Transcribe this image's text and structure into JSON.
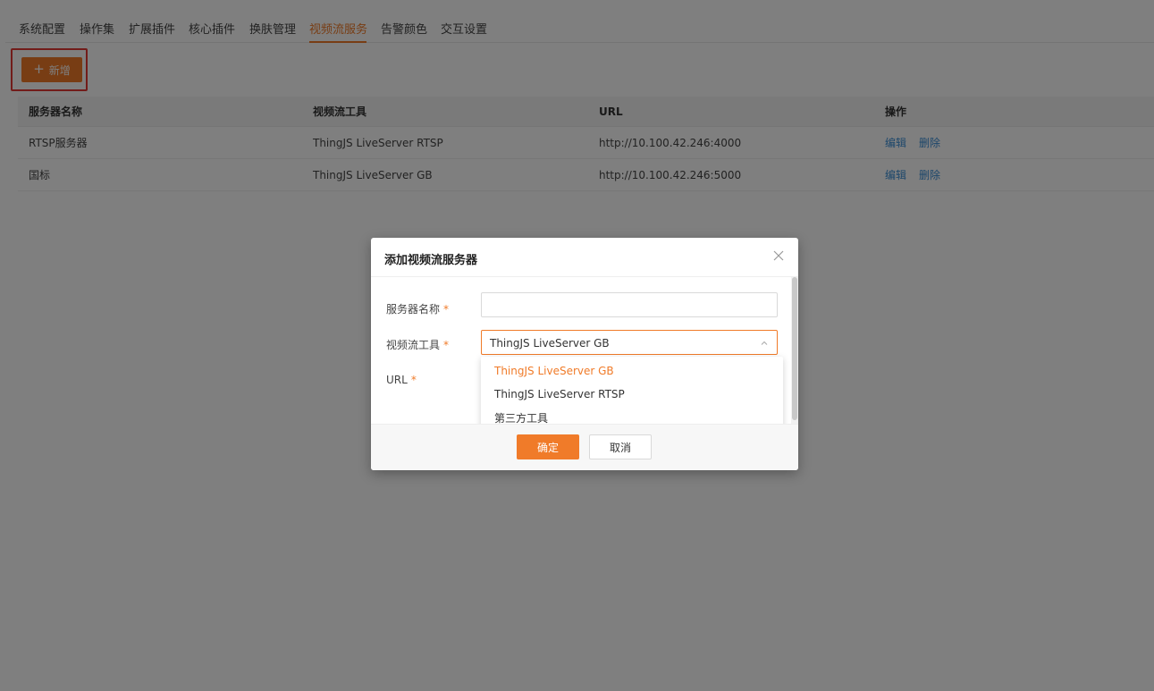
{
  "tabs": [
    {
      "label": "系统配置",
      "active": false
    },
    {
      "label": "操作集",
      "active": false
    },
    {
      "label": "扩展插件",
      "active": false
    },
    {
      "label": "核心插件",
      "active": false
    },
    {
      "label": "换肤管理",
      "active": false
    },
    {
      "label": "视频流服务",
      "active": true
    },
    {
      "label": "告警颜色",
      "active": false
    },
    {
      "label": "交互设置",
      "active": false
    }
  ],
  "toolbar": {
    "add_label": "新增",
    "add_icon": "plus-icon"
  },
  "table": {
    "headers": [
      "服务器名称",
      "视频流工具",
      "URL",
      "操作"
    ],
    "rows": [
      {
        "name": "RTSP服务器",
        "tool": "ThingJS LiveServer RTSP",
        "url": "http://10.100.42.246:4000",
        "edit": "编辑",
        "delete": "删除"
      },
      {
        "name": "国标",
        "tool": "ThingJS LiveServer GB",
        "url": "http://10.100.42.246:5000",
        "edit": "编辑",
        "delete": "删除"
      }
    ]
  },
  "modal": {
    "title": "添加视频流服务器",
    "close_icon": "close-icon",
    "fields": {
      "server_name": {
        "label": "服务器名称",
        "required_mark": "*",
        "value": "",
        "placeholder": ""
      },
      "stream_tool": {
        "label": "视频流工具",
        "required_mark": "*",
        "value": "ThingJS LiveServer GB"
      },
      "url": {
        "label": "URL",
        "required_mark": "*"
      }
    },
    "dropdown_options": [
      {
        "label": "ThingJS LiveServer GB",
        "selected": true
      },
      {
        "label": "ThingJS LiveServer RTSP",
        "selected": false
      },
      {
        "label": "第三方工具",
        "selected": false
      }
    ],
    "ok_label": "确定",
    "cancel_label": "取消"
  },
  "colors": {
    "accent": "#f07b29",
    "link": "#3b8ed6",
    "highlight_border": "#e53935"
  }
}
